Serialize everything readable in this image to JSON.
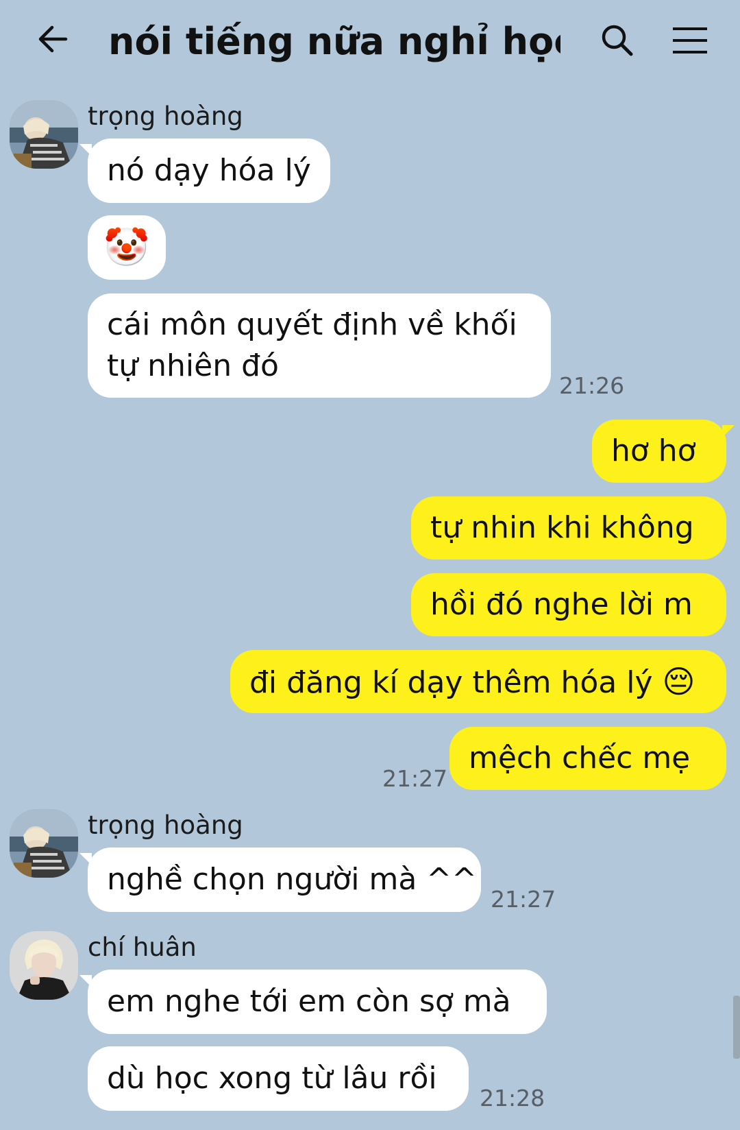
{
  "header": {
    "back_icon": "arrow-left-icon",
    "title": "nói tiếng nữa nghỉ học...",
    "search_icon": "search-icon",
    "menu_icon": "hamburger-menu-icon"
  },
  "colors": {
    "background": "#b2c7d9",
    "incoming_bubble": "#ffffff",
    "outgoing_bubble": "#fef01b"
  },
  "messages": [
    {
      "sender": "trọng hoàng",
      "text": "nó dạy hóa lý"
    },
    {
      "emoji": "🤡",
      "emoji_icon": "clown-face-icon"
    },
    {
      "line1": "cái môn quyết định về khối",
      "line2": "tự nhiên đó",
      "time": "21:26"
    },
    {
      "text": "hơ hơ"
    },
    {
      "text": "tự nhin khi không"
    },
    {
      "text": "hồi đó nghe lời m"
    },
    {
      "text": "đi đăng kí dạy thêm hóa lý",
      "emoji": "😔",
      "emoji_icon": "pensive-face-icon"
    },
    {
      "text": "mệch chếc mẹ",
      "time": "21:27"
    },
    {
      "sender": "trọng hoàng",
      "text": "nghề chọn người mà ^^",
      "time": "21:27"
    },
    {
      "sender": "chí huân",
      "text": "em nghe tới em còn sợ mà"
    },
    {
      "text": "dù học xong từ lâu rồi",
      "time": "21:28"
    }
  ]
}
